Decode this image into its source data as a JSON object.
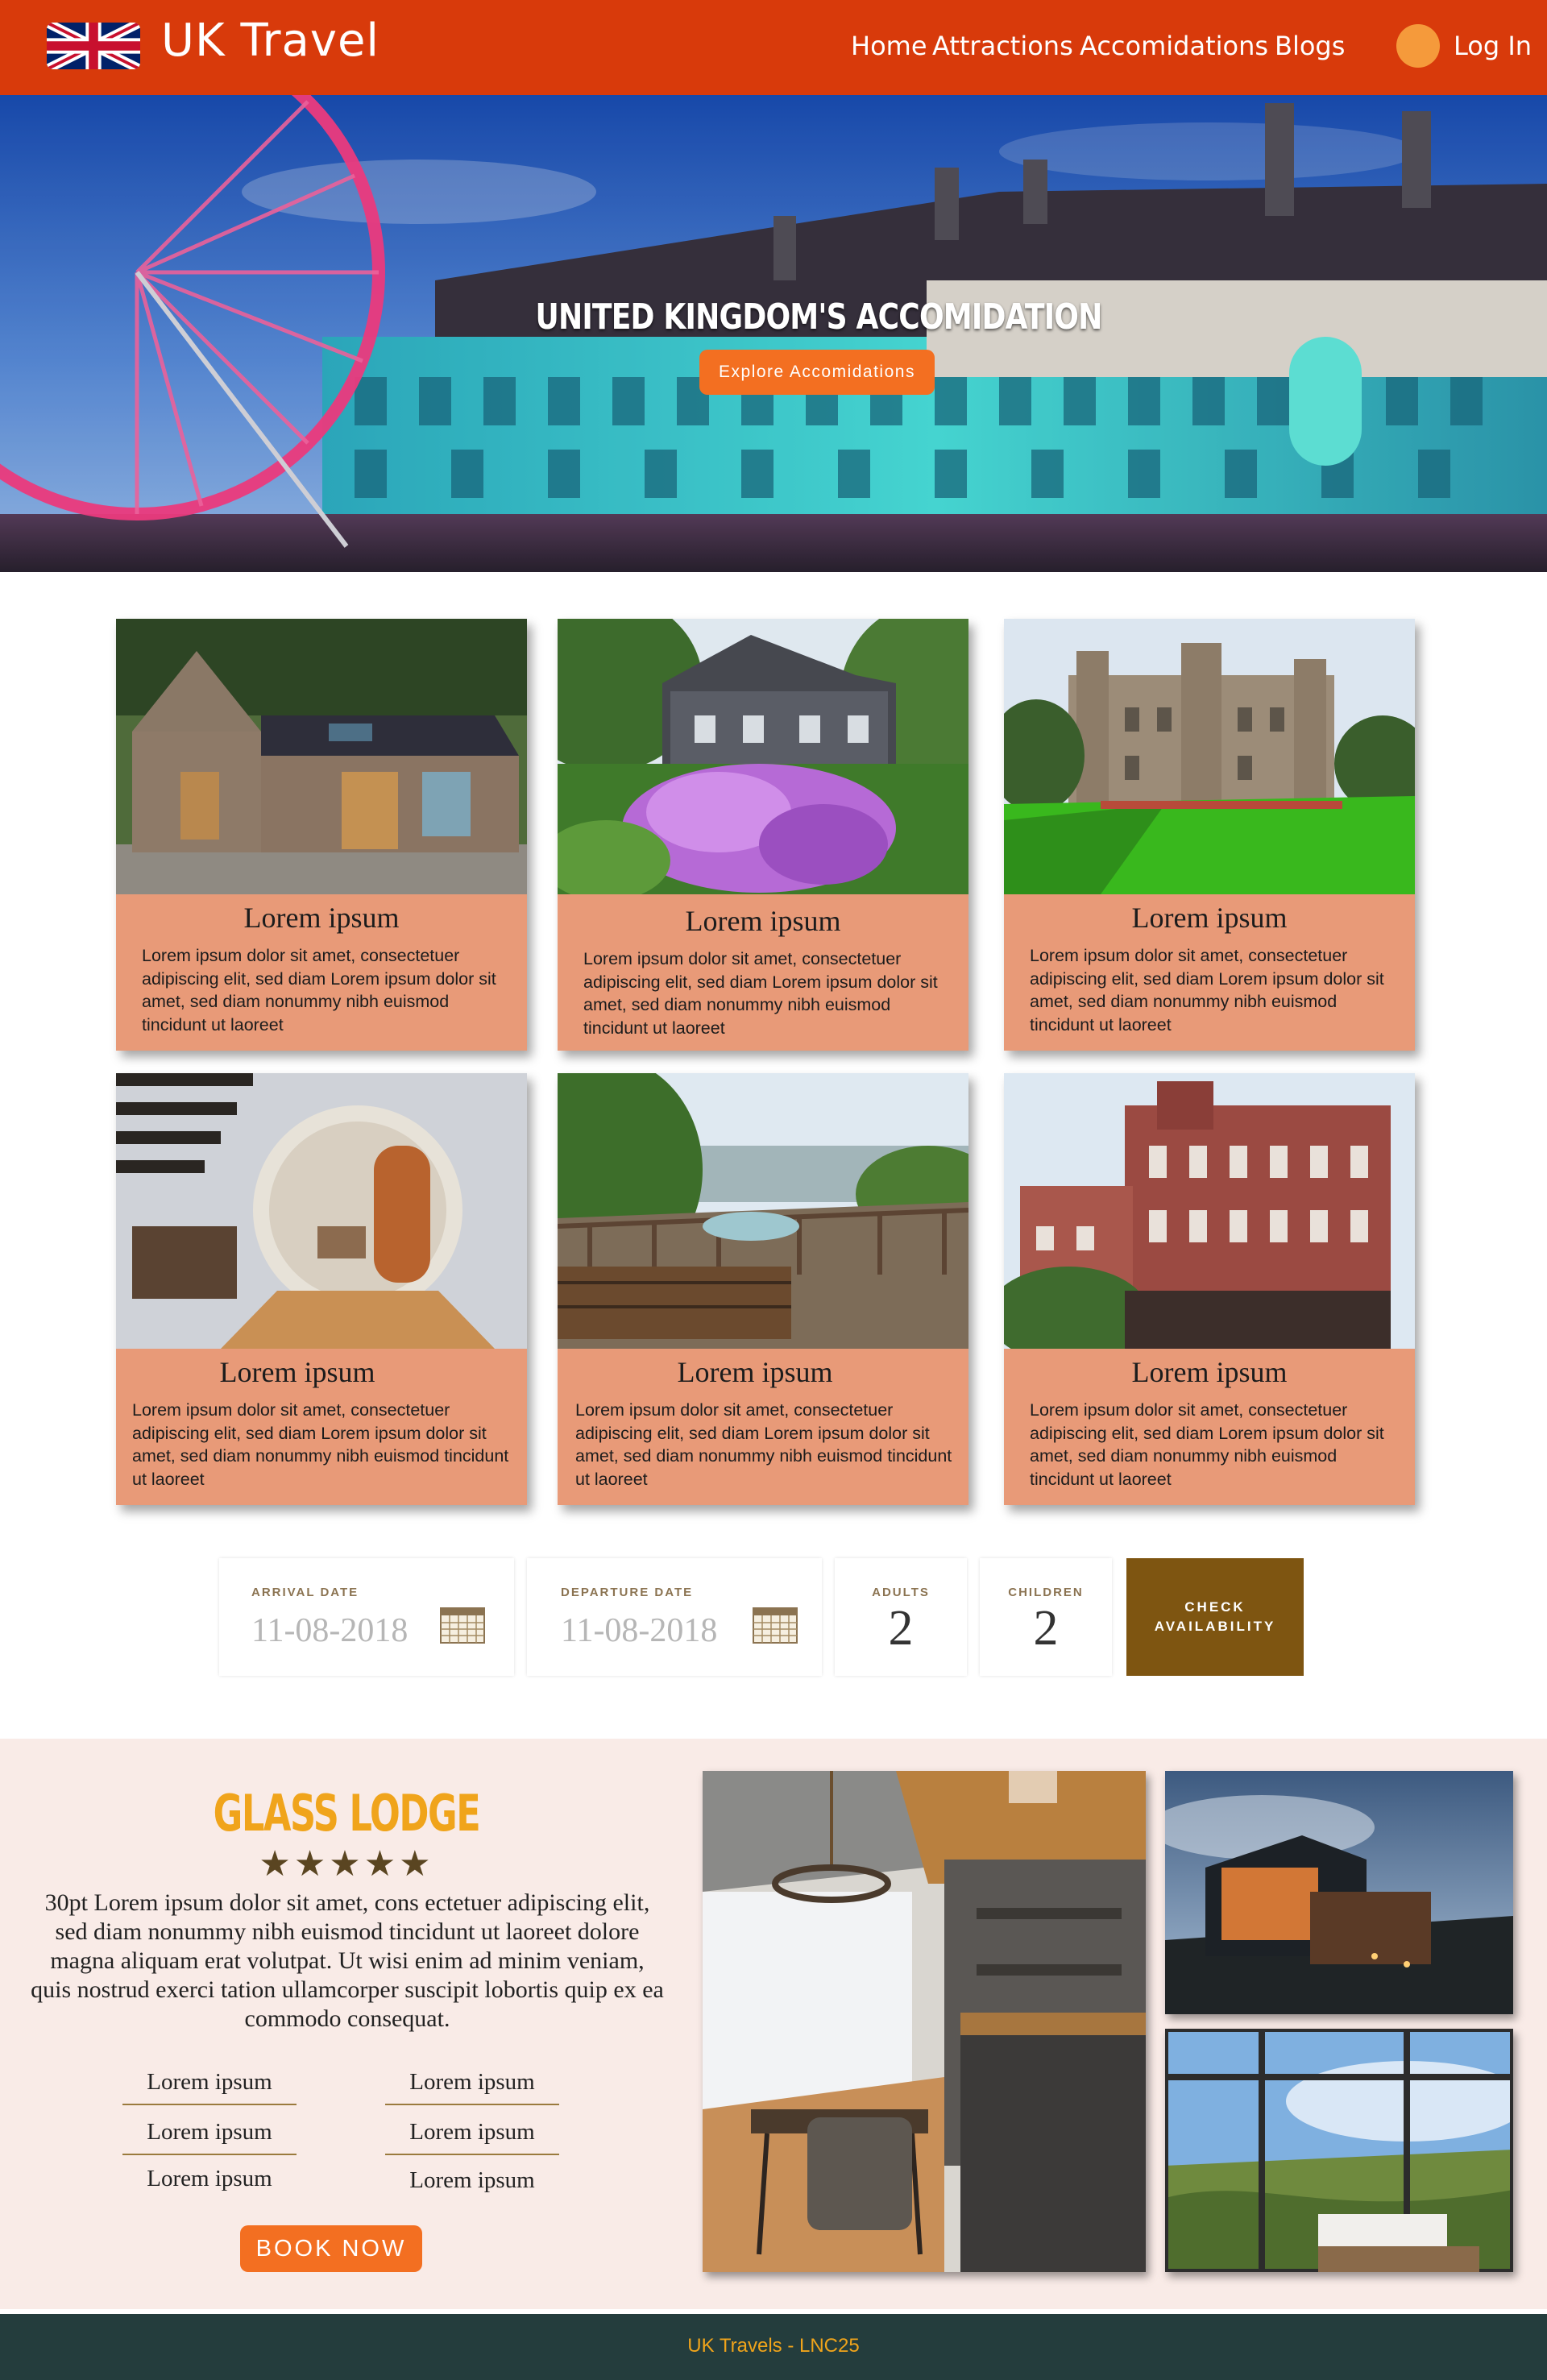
{
  "header": {
    "brand": "UK Travel",
    "nav": [
      "Home",
      "Attractions",
      "Accomidations",
      "Blogs"
    ],
    "login": "Log In"
  },
  "hero": {
    "title": "United Kingdom's Accomidation",
    "button": "Explore Accomidations"
  },
  "cards": [
    {
      "title": "Lorem ipsum",
      "text": "Lorem ipsum dolor sit amet, consectetuer adipiscing elit, sed diam Lorem ipsum dolor sit amet, sed diam nonummy nibh euismod tincidunt ut laoreet"
    },
    {
      "title": "Lorem ipsum",
      "text": "Lorem ipsum dolor sit amet, consectetuer adipiscing elit, sed diam Lorem ipsum dolor sit amet, sed diam nonummy nibh euismod tincidunt ut laoreet"
    },
    {
      "title": "Lorem ipsum",
      "text": "Lorem ipsum dolor sit amet, consectetuer adipiscing elit, sed diam Lorem ipsum dolor sit amet, sed diam nonummy nibh euismod tincidunt ut laoreet"
    },
    {
      "title": "Lorem ipsum",
      "text": "Lorem ipsum dolor sit amet, consectetuer adipiscing elit, sed diam Lorem ipsum dolor sit amet, sed diam nonummy nibh euismod tincidunt ut laoreet"
    },
    {
      "title": "Lorem ipsum",
      "text": "Lorem ipsum dolor sit amet, consectetuer adipiscing elit, sed diam Lorem ipsum dolor sit amet, sed diam nonummy nibh euismod tincidunt ut laoreet"
    },
    {
      "title": "Lorem ipsum",
      "text": "Lorem ipsum dolor sit amet, consectetuer adipiscing elit, sed diam Lorem ipsum dolor sit amet, sed diam nonummy nibh euismod tincidunt ut laoreet"
    }
  ],
  "booking": {
    "arrival_label": "ARRIVAL DATE",
    "arrival_value": "11-08-2018",
    "departure_label": "DEPARTURE DATE",
    "departure_value": "11-08-2018",
    "adults_label": "ADULTS",
    "adults_value": "2",
    "children_label": "CHILDREN",
    "children_value": "2",
    "check_label": "CHECK AVAILABILITY"
  },
  "lodge": {
    "title": "Glass Lodge",
    "stars": "★★★★★",
    "rating": 5,
    "description": "30pt Lorem ipsum dolor sit amet, cons ectetuer adipiscing elit, sed diam nonummy nibh euismod tincidunt ut laoreet dolore magna aliquam erat volutpat. Ut wisi enim ad minim veniam, quis nostrud exerci tation ullamcorper suscipit lobortis quip ex ea commodo consequat.",
    "amenities": [
      "Lorem ipsum",
      "Lorem ipsum",
      "Lorem ipsum",
      "Lorem ipsum",
      "Lorem ipsum",
      "Lorem ipsum"
    ],
    "book_button": "BOOK NOW"
  },
  "footer": {
    "text": "UK Travels - LNC25"
  },
  "colors": {
    "header": "#d83a0b",
    "accent_orange": "#f36f21",
    "card": "#e89a78",
    "check_button": "#7e5511",
    "lodge_bg": "#f9ebe7",
    "lodge_title": "#f0a41b",
    "footer": "#243d3d"
  }
}
